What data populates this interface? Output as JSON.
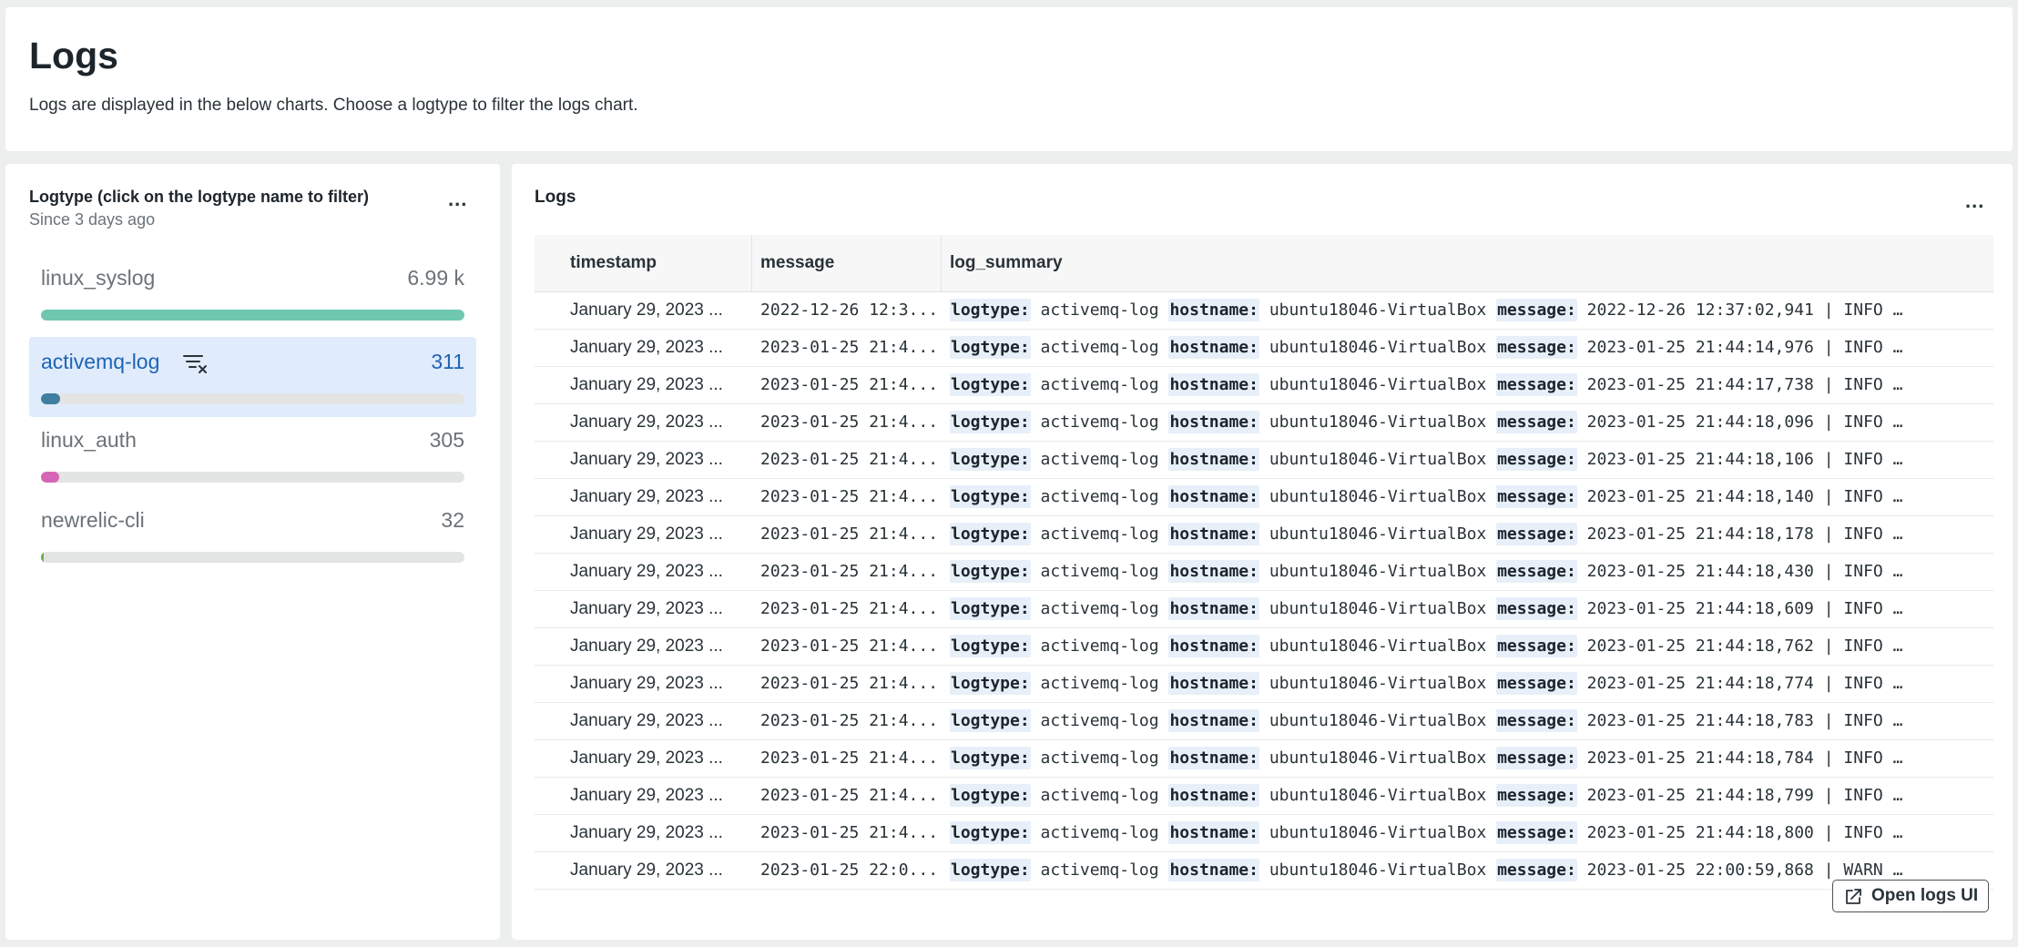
{
  "header": {
    "title": "Logs",
    "description": "Logs are displayed in the below charts. Choose a logtype to filter the logs chart."
  },
  "logtype_panel": {
    "title": "Logtype (click on the logtype name to filter)",
    "subtitle": "Since 3 days ago",
    "menu": "...",
    "items": [
      {
        "name": "linux_syslog",
        "value": "6.99 k",
        "share": 1.0,
        "color": "#6fc7b0",
        "active": false
      },
      {
        "name": "activemq-log",
        "value": "311",
        "share": 0.045,
        "color": "#3f7e9e",
        "active": true,
        "filter_icon": "filter-clear-icon"
      },
      {
        "name": "linux_auth",
        "value": "305",
        "share": 0.044,
        "color": "#d665b5",
        "active": false
      },
      {
        "name": "newrelic-cli",
        "value": "32",
        "share": 0.005,
        "color": "#6ab04c",
        "active": false
      }
    ]
  },
  "logs_panel": {
    "title": "Logs",
    "menu": "...",
    "columns": [
      "timestamp",
      "message",
      "log_summary"
    ],
    "summary_keys": {
      "logtype": "logtype:",
      "hostname": "hostname:",
      "message": "message:"
    },
    "rows": [
      {
        "timestamp": "January 29, 2023 ...",
        "message": "2022-12-26 12:3...",
        "logtype": "activemq-log",
        "hostname": "ubuntu18046-VirtualBox",
        "summary_message": "2022-12-26 12:37:02,941 | INFO …"
      },
      {
        "timestamp": "January 29, 2023 ...",
        "message": "2023-01-25 21:4...",
        "logtype": "activemq-log",
        "hostname": "ubuntu18046-VirtualBox",
        "summary_message": "2023-01-25 21:44:14,976 | INFO …"
      },
      {
        "timestamp": "January 29, 2023 ...",
        "message": "2023-01-25 21:4...",
        "logtype": "activemq-log",
        "hostname": "ubuntu18046-VirtualBox",
        "summary_message": "2023-01-25 21:44:17,738 | INFO …"
      },
      {
        "timestamp": "January 29, 2023 ...",
        "message": "2023-01-25 21:4...",
        "logtype": "activemq-log",
        "hostname": "ubuntu18046-VirtualBox",
        "summary_message": "2023-01-25 21:44:18,096 | INFO …"
      },
      {
        "timestamp": "January 29, 2023 ...",
        "message": "2023-01-25 21:4...",
        "logtype": "activemq-log",
        "hostname": "ubuntu18046-VirtualBox",
        "summary_message": "2023-01-25 21:44:18,106 | INFO …"
      },
      {
        "timestamp": "January 29, 2023 ...",
        "message": "2023-01-25 21:4...",
        "logtype": "activemq-log",
        "hostname": "ubuntu18046-VirtualBox",
        "summary_message": "2023-01-25 21:44:18,140 | INFO …"
      },
      {
        "timestamp": "January 29, 2023 ...",
        "message": "2023-01-25 21:4...",
        "logtype": "activemq-log",
        "hostname": "ubuntu18046-VirtualBox",
        "summary_message": "2023-01-25 21:44:18,178 | INFO …"
      },
      {
        "timestamp": "January 29, 2023 ...",
        "message": "2023-01-25 21:4...",
        "logtype": "activemq-log",
        "hostname": "ubuntu18046-VirtualBox",
        "summary_message": "2023-01-25 21:44:18,430 | INFO …"
      },
      {
        "timestamp": "January 29, 2023 ...",
        "message": "2023-01-25 21:4...",
        "logtype": "activemq-log",
        "hostname": "ubuntu18046-VirtualBox",
        "summary_message": "2023-01-25 21:44:18,609 | INFO …"
      },
      {
        "timestamp": "January 29, 2023 ...",
        "message": "2023-01-25 21:4...",
        "logtype": "activemq-log",
        "hostname": "ubuntu18046-VirtualBox",
        "summary_message": "2023-01-25 21:44:18,762 | INFO …"
      },
      {
        "timestamp": "January 29, 2023 ...",
        "message": "2023-01-25 21:4...",
        "logtype": "activemq-log",
        "hostname": "ubuntu18046-VirtualBox",
        "summary_message": "2023-01-25 21:44:18,774 | INFO …"
      },
      {
        "timestamp": "January 29, 2023 ...",
        "message": "2023-01-25 21:4...",
        "logtype": "activemq-log",
        "hostname": "ubuntu18046-VirtualBox",
        "summary_message": "2023-01-25 21:44:18,783 | INFO …"
      },
      {
        "timestamp": "January 29, 2023 ...",
        "message": "2023-01-25 21:4...",
        "logtype": "activemq-log",
        "hostname": "ubuntu18046-VirtualBox",
        "summary_message": "2023-01-25 21:44:18,784 | INFO …"
      },
      {
        "timestamp": "January 29, 2023 ...",
        "message": "2023-01-25 21:4...",
        "logtype": "activemq-log",
        "hostname": "ubuntu18046-VirtualBox",
        "summary_message": "2023-01-25 21:44:18,799 | INFO …"
      },
      {
        "timestamp": "January 29, 2023 ...",
        "message": "2023-01-25 21:4...",
        "logtype": "activemq-log",
        "hostname": "ubuntu18046-VirtualBox",
        "summary_message": "2023-01-25 21:44:18,800 | INFO …"
      },
      {
        "timestamp": "January 29, 2023 ...",
        "message": "2023-01-25 22:0...",
        "logtype": "activemq-log",
        "hostname": "ubuntu18046-VirtualBox",
        "summary_message": "2023-01-25 22:00:59,868 | WARN …"
      }
    ],
    "open_button": {
      "label": "Open logs UI",
      "icon": "external-link-icon"
    }
  }
}
